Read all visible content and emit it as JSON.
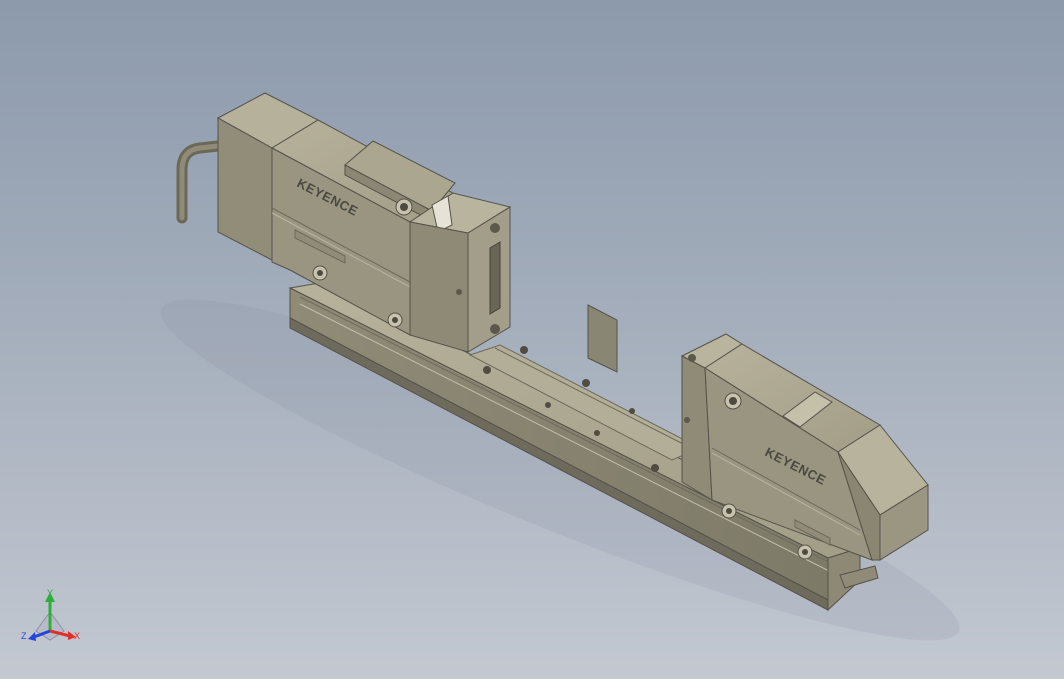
{
  "viewport": {
    "background_top": "#8c9aac",
    "background_bottom": "#c3c8d1"
  },
  "model": {
    "body_color": "#a6a18c",
    "rail_color": "#9d9885",
    "sensors": [
      {
        "logo": "KEYENCE"
      },
      {
        "logo": "KEYENCE"
      }
    ]
  },
  "triad": {
    "x_label": "X",
    "y_label": "Y",
    "z_label": "Z",
    "x_color": "#e0302a",
    "y_color": "#2fae3a",
    "z_color": "#2546d8"
  }
}
